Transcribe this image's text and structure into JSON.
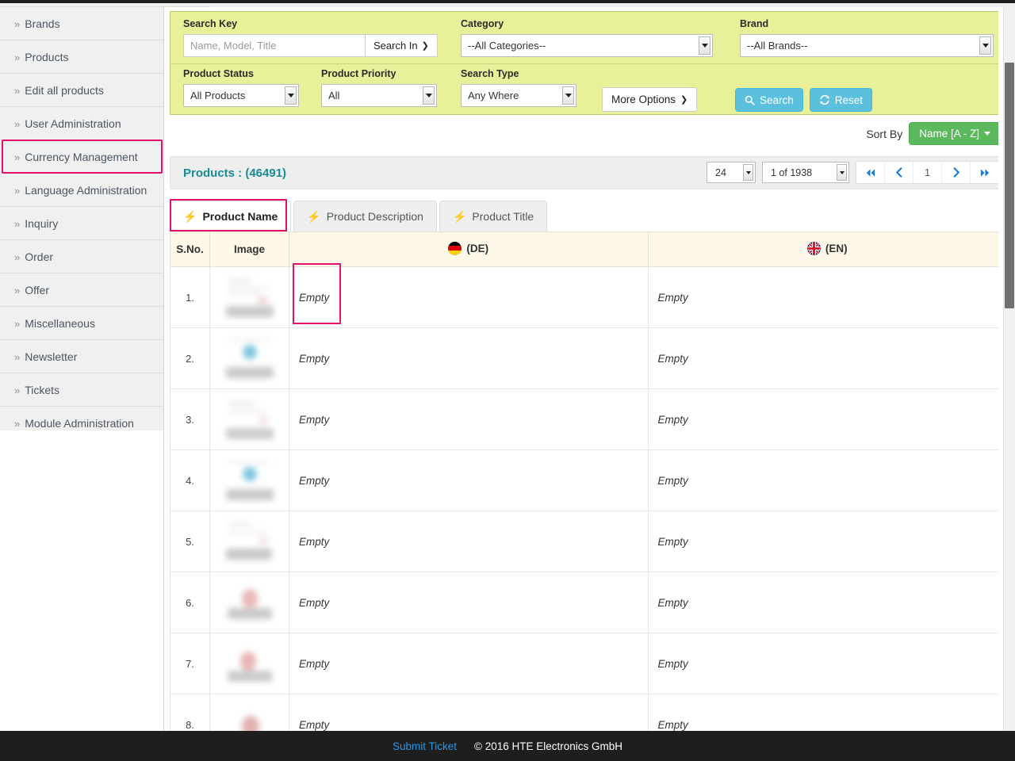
{
  "sidebar": {
    "items": [
      {
        "label": "Brands",
        "name": "brands"
      },
      {
        "label": "Products",
        "name": "products"
      },
      {
        "label": "Edit all products",
        "name": "edit-all-products"
      },
      {
        "label": "User Administration",
        "name": "user-administration"
      },
      {
        "label": "Currency Management",
        "name": "currency-management"
      },
      {
        "label": "Language Administration",
        "name": "language-administration"
      },
      {
        "label": "Inquiry",
        "name": "inquiry"
      },
      {
        "label": "Order",
        "name": "order"
      },
      {
        "label": "Offer",
        "name": "offer"
      },
      {
        "label": "Miscellaneous",
        "name": "miscellaneous"
      },
      {
        "label": "Newsletter",
        "name": "newsletter"
      },
      {
        "label": "Tickets",
        "name": "tickets"
      },
      {
        "label": "Module Administration",
        "name": "module-administration"
      }
    ],
    "chevron": "»",
    "highlighted": "Edit all products"
  },
  "search_panel": {
    "search_key_label": "Search Key",
    "search_key_value": "",
    "search_key_placeholder": "Name, Model, Title",
    "search_in_label": "Search In",
    "category_label": "Category",
    "category_value": "--All Categories--",
    "brand_label": "Brand",
    "brand_value": "--All Brands--",
    "product_status_label": "Product Status",
    "product_status_value": "All Products",
    "product_priority_label": "Product Priority",
    "product_priority_value": "All",
    "search_type_label": "Search Type",
    "search_type_value": "Any Where",
    "more_options_label": "More Options",
    "search_button_label": "Search",
    "reset_button_label": "Reset",
    "accent_color": "#5bc0de",
    "panel_color": "#e8f09a"
  },
  "sort": {
    "label": "Sort By",
    "value": "Name [A - Z]",
    "color": "#5cb85c"
  },
  "results": {
    "title": "Products : (46491)",
    "per_page": "24",
    "page_of": "1 of 1938",
    "current_page": "1",
    "first_icon": "first-page-icon",
    "prev_icon": "previous-page-icon",
    "next_icon": "next-page-icon",
    "last_icon": "last-page-icon"
  },
  "tabs": [
    {
      "label": "Product Name",
      "active": true
    },
    {
      "label": "Product Description",
      "active": false
    },
    {
      "label": "Product Title",
      "active": false
    }
  ],
  "table": {
    "headers": {
      "sno": "S.No.",
      "image": "Image",
      "de": "(DE)",
      "en": "(EN)"
    },
    "rows": [
      {
        "sno": "1.",
        "de": "Empty",
        "en": "Empty"
      },
      {
        "sno": "2.",
        "de": "Empty",
        "en": "Empty"
      },
      {
        "sno": "3.",
        "de": "Empty",
        "en": "Empty"
      },
      {
        "sno": "4.",
        "de": "Empty",
        "en": "Empty"
      },
      {
        "sno": "5.",
        "de": "Empty",
        "en": "Empty"
      },
      {
        "sno": "6.",
        "de": "Empty",
        "en": "Empty"
      },
      {
        "sno": "7.",
        "de": "Empty",
        "en": "Empty"
      },
      {
        "sno": "8.",
        "de": "Empty",
        "en": "Empty"
      }
    ]
  },
  "footer": {
    "submit_ticket": "Submit Ticket",
    "copyright": "© 2016 HTE Electronics GmbH"
  },
  "highlight_color": "#e3106e"
}
